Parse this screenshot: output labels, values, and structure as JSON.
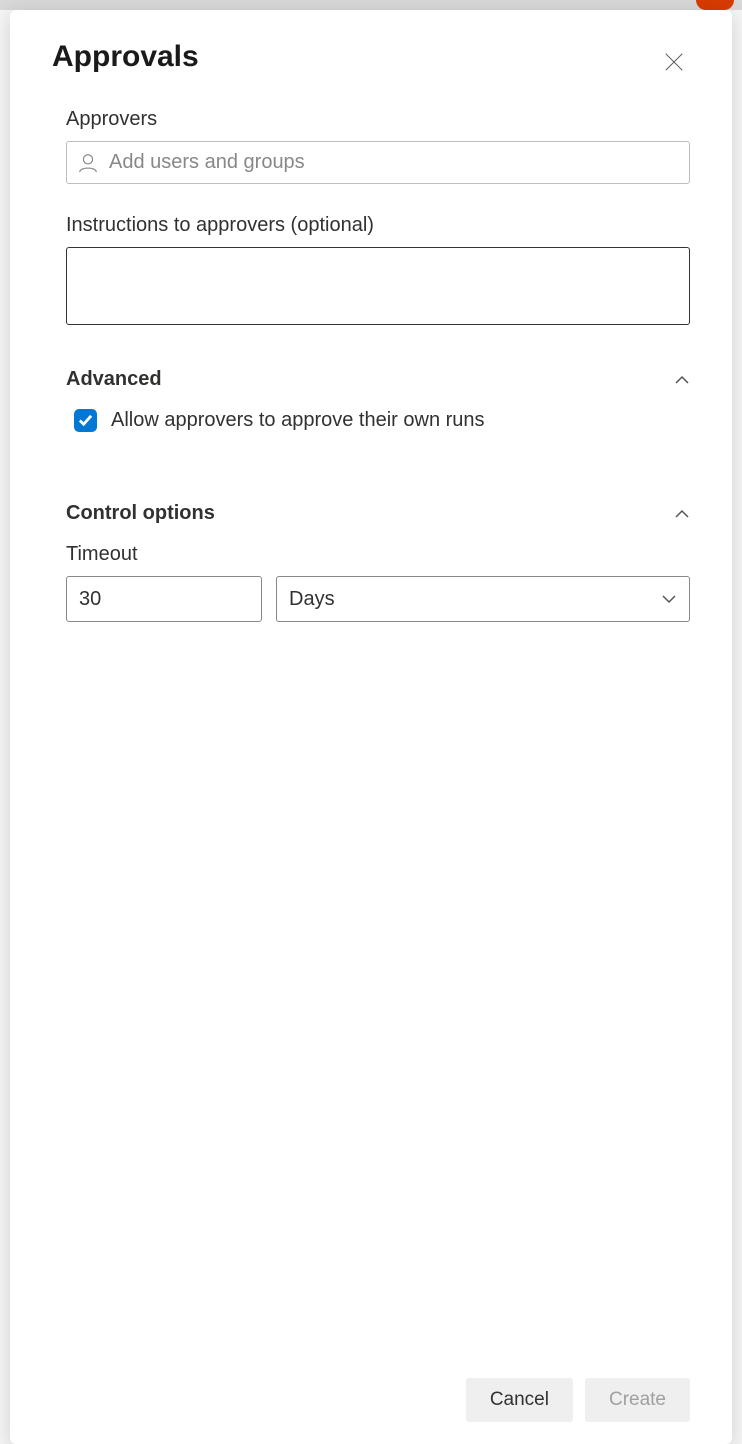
{
  "panel": {
    "title": "Approvals"
  },
  "approvers": {
    "label": "Approvers",
    "placeholder": "Add users and groups"
  },
  "instructions": {
    "label": "Instructions to approvers (optional)",
    "value": ""
  },
  "advanced": {
    "title": "Advanced",
    "checkbox_label": "Allow approvers to approve their own runs",
    "checked": true
  },
  "control_options": {
    "title": "Control options",
    "timeout_label": "Timeout",
    "timeout_value": "30",
    "timeout_unit": "Days"
  },
  "footer": {
    "cancel_label": "Cancel",
    "create_label": "Create"
  }
}
